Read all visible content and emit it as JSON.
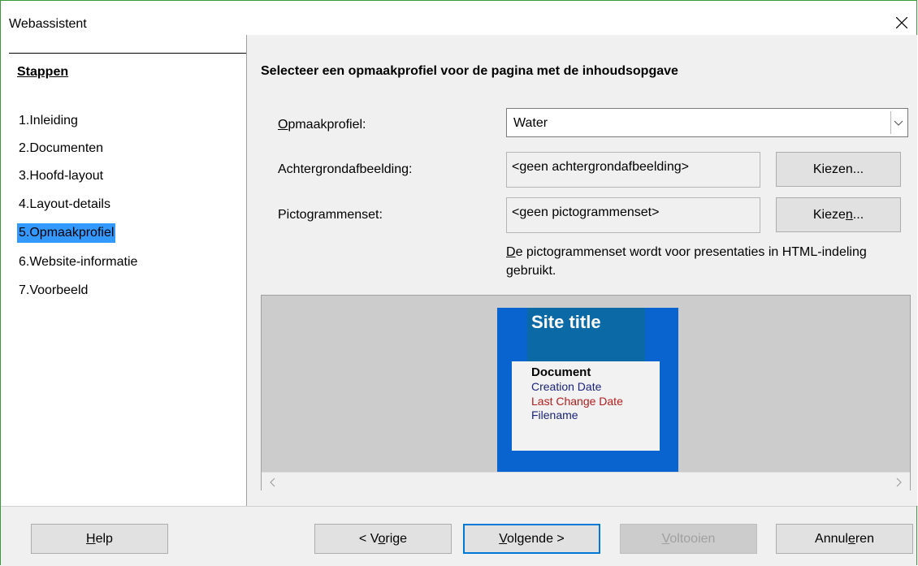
{
  "window": {
    "title": "Webassistent"
  },
  "steps": {
    "heading": "Stappen",
    "items": [
      {
        "label": "1.Inleiding"
      },
      {
        "label": "2.Documenten"
      },
      {
        "label": "3.Hoofd-layout"
      },
      {
        "label": "4.Layout-details"
      },
      {
        "label": "5.Opmaakprofiel"
      },
      {
        "label": "6.Website-informatie"
      },
      {
        "label": "7.Voorbeeld"
      }
    ],
    "active_index": 4
  },
  "main": {
    "heading": "Selecteer een opmaakprofiel voor de pagina met de inhoudsopgave",
    "style_label_underlined": "O",
    "style_label_rest": "pmaakprofiel:",
    "style_value": "Water",
    "background_label": "Achtergrondafbeelding:",
    "background_value": "<geen achtergrondafbeelding>",
    "background_button": "Kiezen...",
    "iconset_label": "Pictogrammenset:",
    "iconset_value": "<geen pictogrammenset>",
    "iconset_button_pre": "Kieze",
    "iconset_button_ul": "n",
    "iconset_button_post": "...",
    "note_ul": "D",
    "note_rest": "e pictogrammenset wordt voor presentaties in HTML-indeling gebruikt."
  },
  "preview": {
    "site_title": "Site title",
    "doc_title": "Document",
    "creation_date": "Creation Date",
    "last_change": "Last Change Date",
    "filename": "Filename",
    "colors": {
      "page_bg": "#0a64cf",
      "header_bg": "#0b6aa6",
      "creation_color": "#1a237e",
      "last_change_color": "#b71c1c",
      "filename_color": "#1a237e"
    }
  },
  "footer": {
    "help_ul": "H",
    "help_rest": "elp",
    "back_pre": "< V",
    "back_ul": "o",
    "back_post": "rige",
    "next_ul": "V",
    "next_rest": "olgende >",
    "finish_ul": "V",
    "finish_rest": "oltooien",
    "cancel_pre": "Annul",
    "cancel_ul": "e",
    "cancel_post": "ren"
  }
}
